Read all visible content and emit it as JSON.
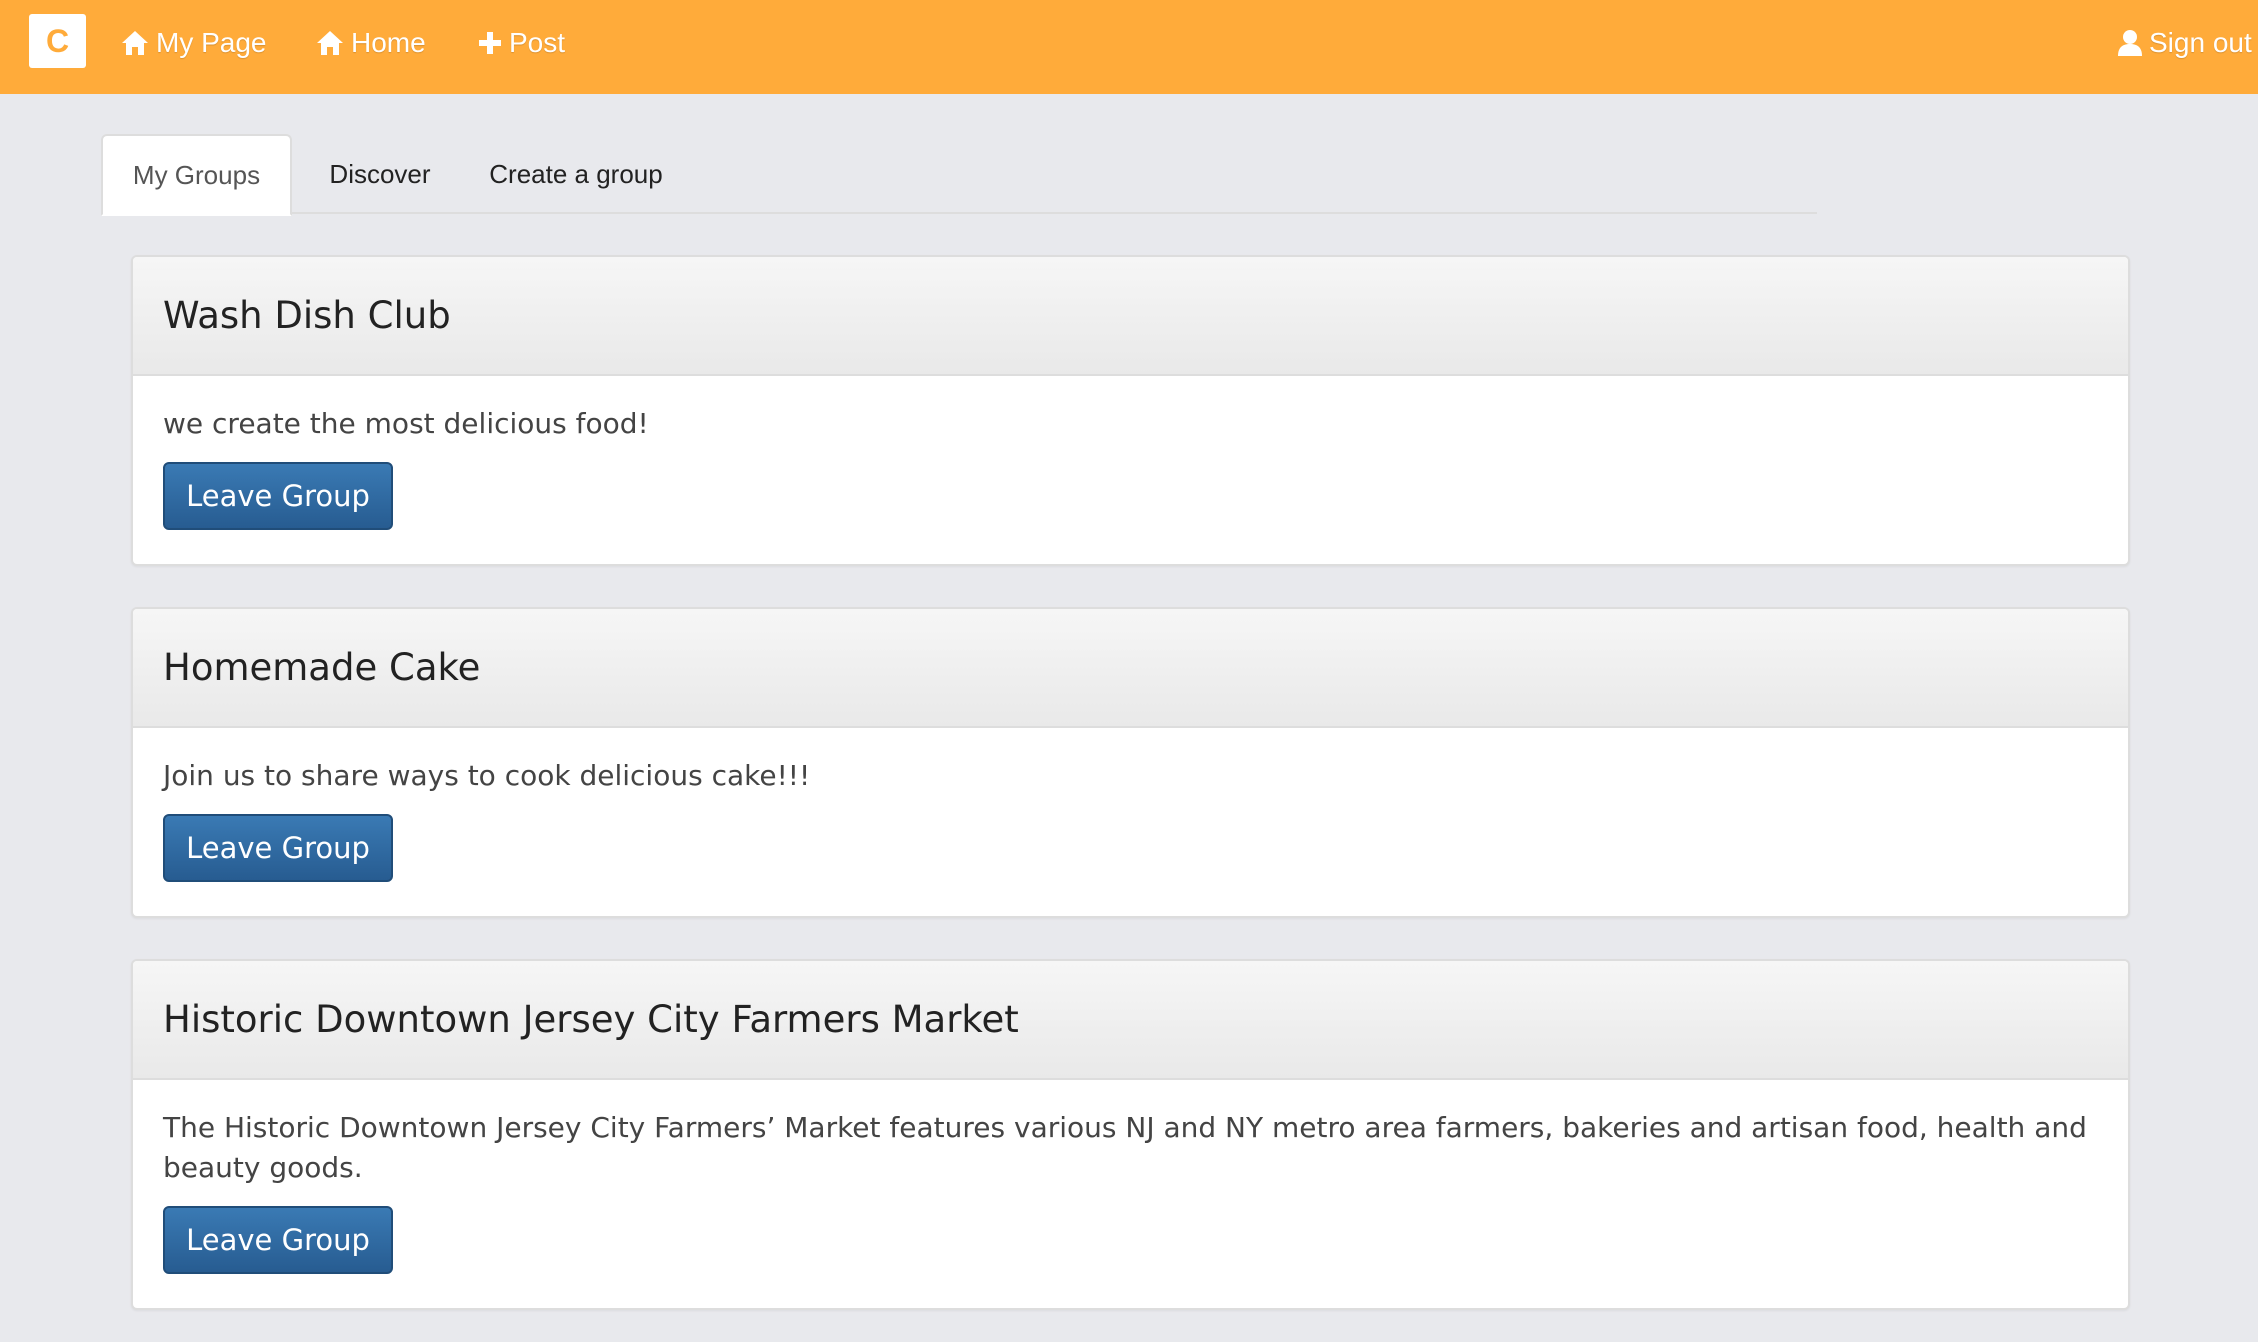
{
  "topbar": {
    "logo_letter": "C",
    "nav": [
      {
        "label": "My Page",
        "icon": "home-icon"
      },
      {
        "label": "Home",
        "icon": "home-icon"
      },
      {
        "label": "Post",
        "icon": "plus-icon"
      }
    ],
    "sign_out": {
      "label": "Sign out",
      "icon": "user-icon"
    }
  },
  "tabs": [
    {
      "label": "My Groups",
      "active": true
    },
    {
      "label": "Discover",
      "active": false
    },
    {
      "label": "Create a group",
      "active": false
    }
  ],
  "groups": [
    {
      "name": "Wash Dish Club",
      "description": "we create the most delicious food!",
      "button": "Leave Group"
    },
    {
      "name": "Homemade Cake",
      "description": "Join us to share ways to cook delicious cake!!!",
      "button": "Leave Group"
    },
    {
      "name": "Historic Downtown Jersey City Farmers Market",
      "description": "The Historic Downtown Jersey City Farmers’ Market features various NJ and NY metro area farmers, bakeries and artisan food, health and beauty goods.",
      "button": "Leave Group"
    }
  ],
  "colors": {
    "topbar": "#ffab3a",
    "background": "#e8e9ed",
    "button": "#2e6da4"
  }
}
